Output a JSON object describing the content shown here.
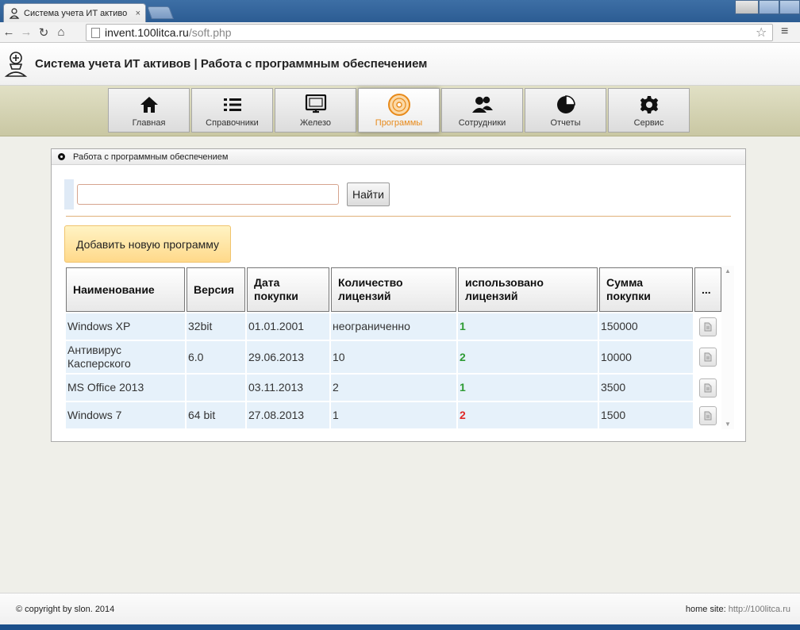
{
  "browser": {
    "tab_title": "Система учета ИТ активо",
    "tab_close": "×",
    "url_host": "invent.100litca.ru",
    "url_path": "/soft.php"
  },
  "site": {
    "title": "Система учета ИТ активов | Работа с программным обеспечением"
  },
  "nav": {
    "items": [
      {
        "label": "Главная",
        "icon": "home-icon"
      },
      {
        "label": "Справочники",
        "icon": "list-icon"
      },
      {
        "label": "Железо",
        "icon": "monitor-icon"
      },
      {
        "label": "Программы",
        "icon": "disc-icon",
        "active": true
      },
      {
        "label": "Сотрудники",
        "icon": "users-icon"
      },
      {
        "label": "Отчеты",
        "icon": "pie-chart-icon"
      },
      {
        "label": "Сервис",
        "icon": "gear-icon"
      }
    ]
  },
  "panel": {
    "title": "Работа с программным обеспечением",
    "search_value": "",
    "search_button": "Найти",
    "add_button": "Добавить новую программу"
  },
  "table": {
    "headers": [
      "Наименование",
      "Версия",
      "Дата покупки",
      "Количество лицензий",
      "использовано лицензий",
      "Сумма покупки",
      "..."
    ],
    "rows": [
      {
        "name": "Windows XP",
        "version": "32bit",
        "date": "01.01.2001",
        "licenses": "неограниченно",
        "used": "1",
        "used_status": "ok",
        "sum": "150000"
      },
      {
        "name": "Антивирус Касперского",
        "version": "6.0",
        "date": "29.06.2013",
        "licenses": "10",
        "used": "2",
        "used_status": "ok",
        "sum": "10000"
      },
      {
        "name": "MS Office 2013",
        "version": "",
        "date": "03.11.2013",
        "licenses": "2",
        "used": "1",
        "used_status": "ok",
        "sum": "3500"
      },
      {
        "name": "Windows 7",
        "version": "64 bit",
        "date": "27.08.2013",
        "licenses": "1",
        "used": "2",
        "used_status": "over",
        "sum": "1500"
      }
    ]
  },
  "footer": {
    "copyright": "© copyright by slon. 2014",
    "home_label": "home site:",
    "home_link": "http://100litca.ru"
  },
  "colors": {
    "active_nav": "#e88a1a",
    "used_ok": "#2e9b34",
    "used_over": "#e02828",
    "add_button_bg": "#ffd98a"
  }
}
